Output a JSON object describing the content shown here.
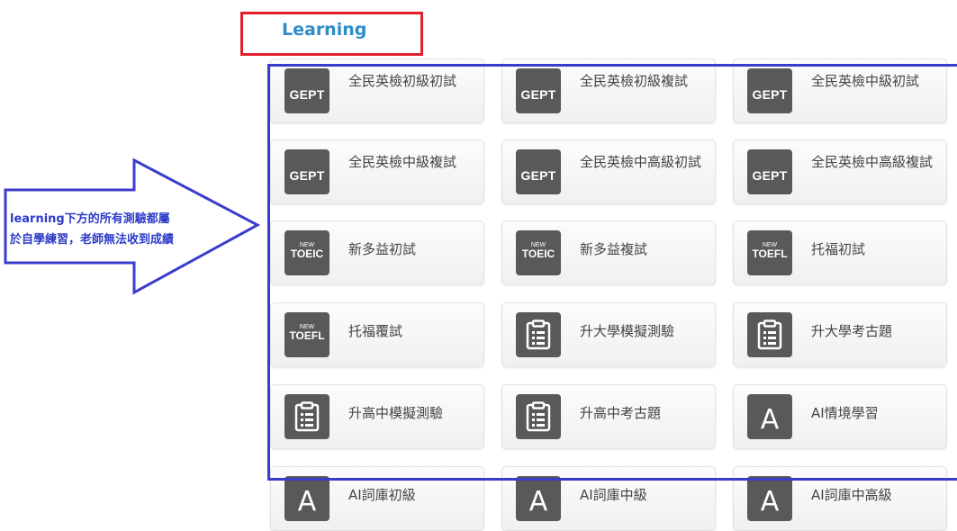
{
  "section": {
    "title": "Learning"
  },
  "annotation": {
    "line1": "learning下方的所有測驗都屬",
    "line2": "於自學練習，老師無法收到成績"
  },
  "colors": {
    "title": "#2d8cc8",
    "red_box": "#e2202c",
    "blue_box": "#3c3ccc",
    "badge": "#595959"
  },
  "cards": [
    {
      "label": "全民英檢初級初試",
      "icon": "gept-icon",
      "badge": "GEPT"
    },
    {
      "label": "全民英檢初級複試",
      "icon": "gept-icon",
      "badge": "GEPT"
    },
    {
      "label": "全民英檢中級初試",
      "icon": "gept-icon",
      "badge": "GEPT"
    },
    {
      "label": "全民英檢中級複試",
      "icon": "gept-icon",
      "badge": "GEPT"
    },
    {
      "label": "全民英檢中高級初試",
      "icon": "gept-icon",
      "badge": "GEPT"
    },
    {
      "label": "全民英檢中高級複試",
      "icon": "gept-icon",
      "badge": "GEPT"
    },
    {
      "label": "新多益初試",
      "icon": "toeic-icon",
      "badge_new": "NEW",
      "badge": "TOEIC"
    },
    {
      "label": "新多益複試",
      "icon": "toeic-icon",
      "badge_new": "NEW",
      "badge": "TOEIC"
    },
    {
      "label": "托福初試",
      "icon": "toefl-icon",
      "badge_new": "NEW",
      "badge": "TOEFL"
    },
    {
      "label": "托福覆試",
      "icon": "toefl-icon",
      "badge_new": "NEW",
      "badge": "TOEFL"
    },
    {
      "label": "升大學模擬測驗",
      "icon": "clipboard-icon"
    },
    {
      "label": "升大學考古題",
      "icon": "clipboard-icon"
    },
    {
      "label": "升高中模擬測驗",
      "icon": "clipboard-icon"
    },
    {
      "label": "升高中考古題",
      "icon": "clipboard-icon"
    },
    {
      "label": "AI情境學習",
      "icon": "letter-a-icon",
      "badge": "A"
    },
    {
      "label": "AI詞庫初級",
      "icon": "letter-a-icon",
      "badge": "A"
    },
    {
      "label": "AI詞庫中級",
      "icon": "letter-a-icon",
      "badge": "A"
    },
    {
      "label": "AI詞庫中高級",
      "icon": "letter-a-icon",
      "badge": "A"
    }
  ]
}
